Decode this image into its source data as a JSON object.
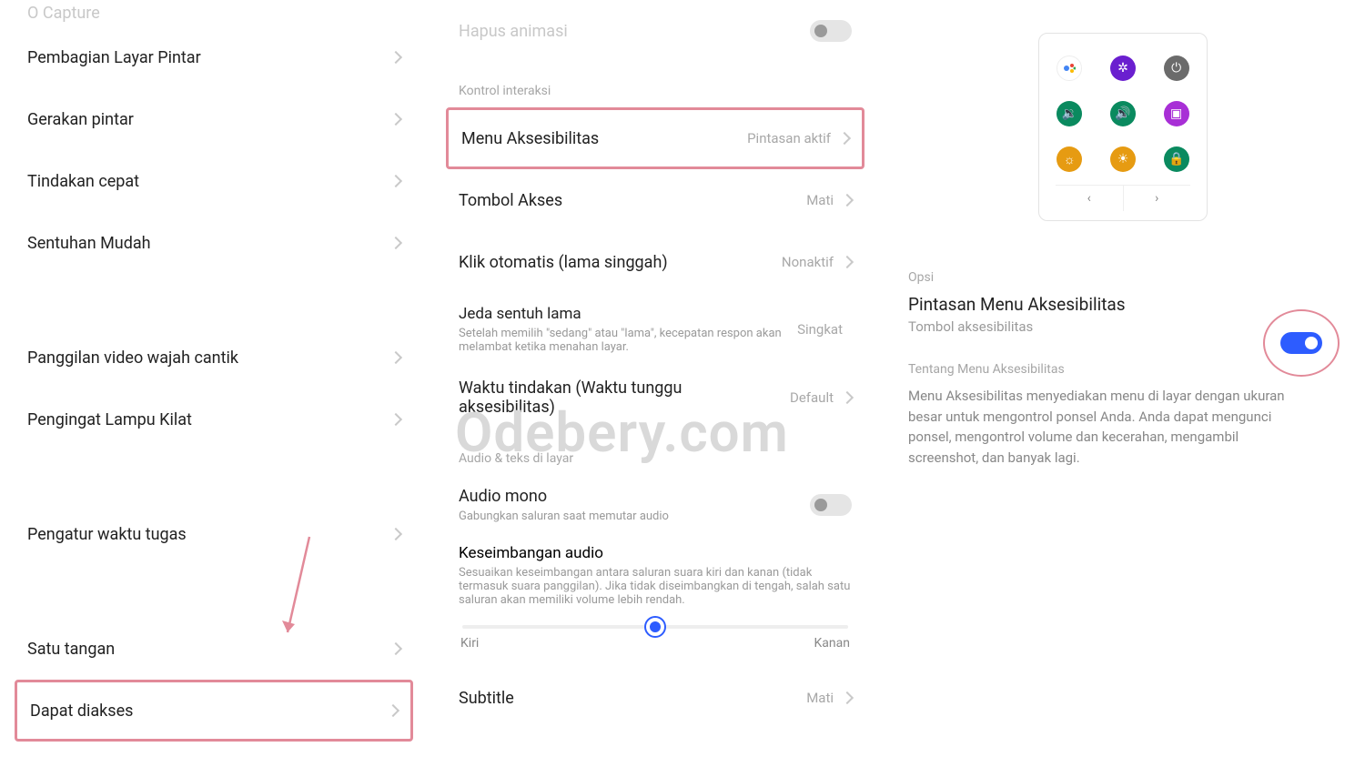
{
  "left": {
    "item0_cut": "O Capture",
    "items": [
      "Pembagian Layar Pintar",
      "Gerakan pintar",
      "Tindakan cepat",
      "Sentuhan Mudah",
      "Panggilan video wajah cantik",
      "Pengingat Lampu Kilat",
      "Pengatur waktu tugas",
      "Satu tangan",
      "Dapat diakses"
    ]
  },
  "mid": {
    "top_cut": "Hapus animasi",
    "sec1": "Kontrol interaksi",
    "rows": {
      "menu": {
        "label": "Menu Aksesibilitas",
        "value": "Pintasan aktif"
      },
      "tombol": {
        "label": "Tombol Akses",
        "value": "Mati"
      },
      "klik": {
        "label": "Klik otomatis (lama singgah)",
        "value": "Nonaktif"
      },
      "jeda": {
        "label": "Jeda sentuh lama",
        "sub": "Setelah memilih \"sedang\" atau \"lama\", kecepatan respon akan melambat ketika menahan layar.",
        "value": "Singkat"
      },
      "waktu": {
        "label": "Waktu tindakan (Waktu tunggu aksesibilitas)",
        "value": "Default"
      }
    },
    "sec2": "Audio & teks di layar",
    "audio_mono": {
      "label": "Audio mono",
      "sub": "Gabungkan saluran saat memutar audio"
    },
    "balance": {
      "label": "Keseimbangan audio",
      "sub": "Sesuaikan keseimbangan antara saluran suara kiri dan kanan (tidak termasuk suara panggilan). Jika tidak diseimbangkan di tengah, salah satu saluran akan memiliki volume lebih rendah."
    },
    "slider": {
      "left": "Kiri",
      "right": "Kanan"
    },
    "subtitle": {
      "label": "Subtitle",
      "value": "Mati"
    }
  },
  "right": {
    "opsi": "Opsi",
    "title": "Pintasan Menu Aksesibilitas",
    "sub": "Tombol aksesibilitas",
    "about": "Tentang Menu Aksesibilitas",
    "desc": "Menu Aksesibilitas menyediakan menu di layar dengan ukuran besar untuk mengontrol ponsel Anda. Anda dapat mengunci ponsel, mengontrol volume dan kecerahan, mengambil screenshot, dan banyak lagi."
  },
  "watermark": "Odebery.com"
}
